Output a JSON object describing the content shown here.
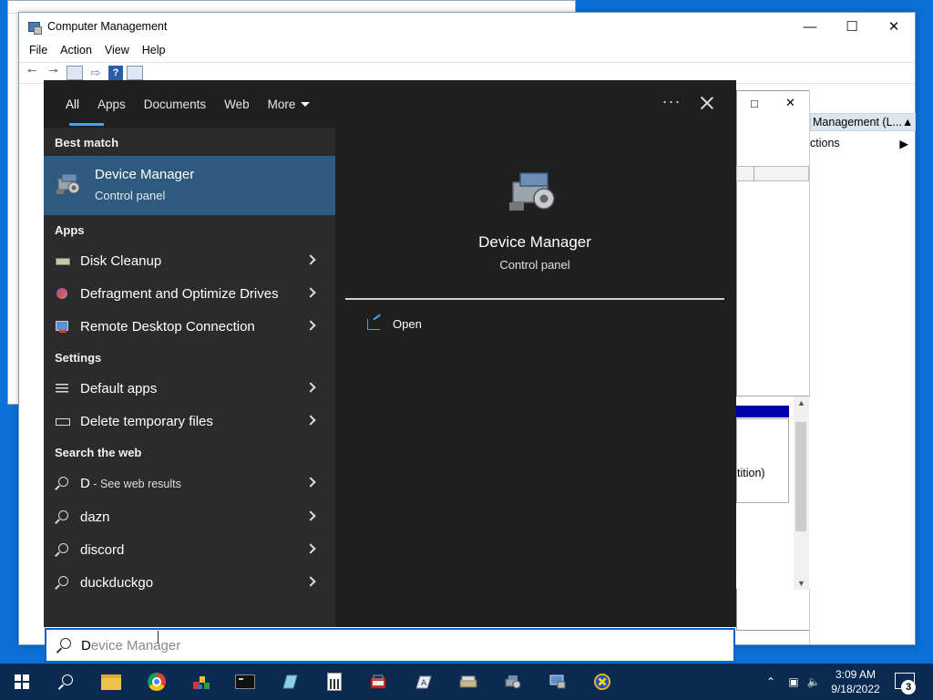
{
  "computer_management": {
    "title": "Computer Management",
    "menu": [
      "File",
      "Action",
      "View",
      "Help"
    ],
    "inner_window_controls": [
      "□",
      "✕"
    ],
    "actions_header": "Management (L...",
    "actions_sub": "ctions",
    "disk_text": "tition)"
  },
  "search": {
    "tabs": [
      "All",
      "Apps",
      "Documents",
      "Web",
      "More"
    ],
    "more_options": "···",
    "sections": {
      "best_match": "Best match",
      "apps": "Apps",
      "settings": "Settings",
      "web": "Search the web"
    },
    "best_match": {
      "title": "Device Manager",
      "subtitle": "Control panel"
    },
    "apps": [
      {
        "label": "Disk Cleanup",
        "icon": "disk-cleanup-icon"
      },
      {
        "label": "Defragment and Optimize Drives",
        "icon": "defrag-icon"
      },
      {
        "label": "Remote Desktop Connection",
        "icon": "remote-desktop-icon"
      }
    ],
    "settings": [
      {
        "label": "Default apps",
        "icon": "list-icon"
      },
      {
        "label": "Delete temporary files",
        "icon": "drive-icon"
      }
    ],
    "web": [
      {
        "label": "D",
        "suffix": " - See web results"
      },
      {
        "label": "dazn"
      },
      {
        "label": "discord"
      },
      {
        "label": "duckduckgo"
      }
    ],
    "preview": {
      "title": "Device Manager",
      "subtitle": "Control panel",
      "action": "Open"
    },
    "query_typed": "D",
    "query_suggestion": "evice Manager"
  },
  "taskbar": {
    "time": "3:09 AM",
    "date": "9/18/2022",
    "notification_count": "3"
  },
  "colors": {
    "desktop": "#0a6fd6",
    "flyout_bg": "#1f1f1f",
    "flyout_left": "#2b2b2b",
    "selection": "#2f5a80",
    "accent": "#4ea1e8",
    "taskbar": "#0b2a52"
  }
}
